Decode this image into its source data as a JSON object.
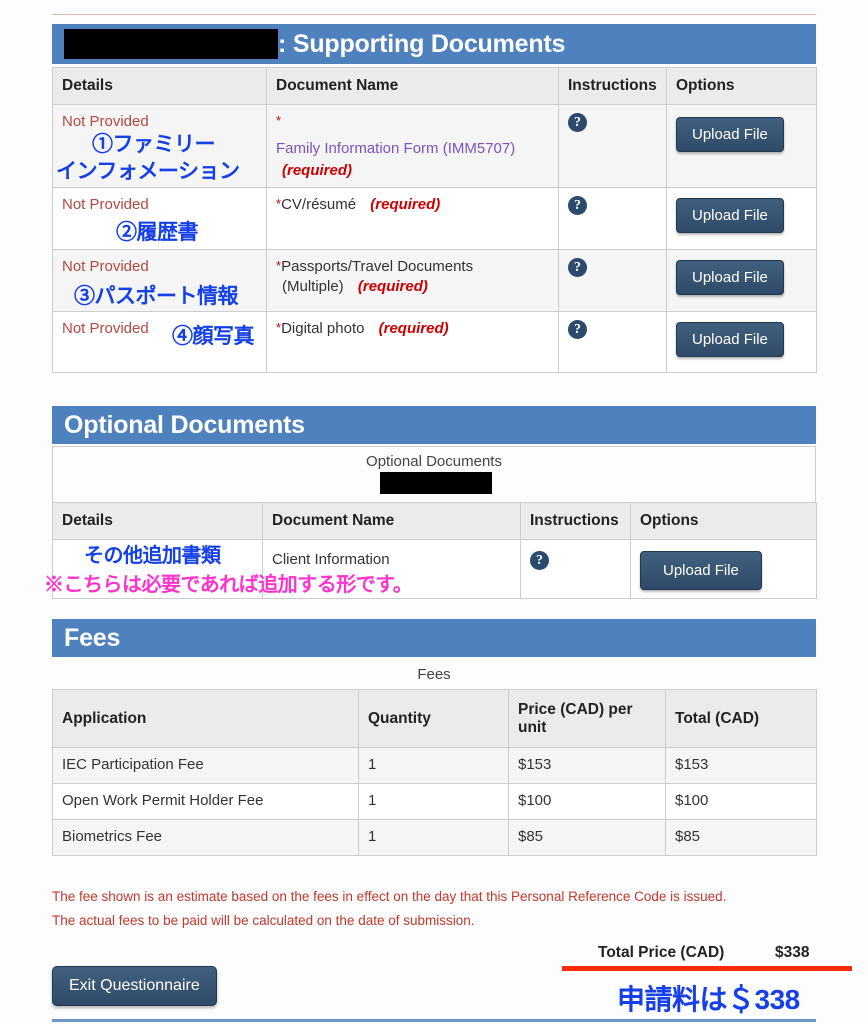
{
  "sections": {
    "supporting": {
      "title_suffix": ": Supporting Documents",
      "redacted_label": "redacted-name"
    },
    "optional": {
      "title": "Optional Documents",
      "caption": "Optional Documents",
      "redacted_label": "redacted-name"
    },
    "fees": {
      "title": "Fees",
      "caption": "Fees"
    }
  },
  "supporting_table": {
    "headers": [
      "Details",
      "Document Name",
      "Instructions",
      "Options"
    ],
    "rows": [
      {
        "status": "Not Provided",
        "asterisk": "*",
        "doc_name": "Family Information Form (IMM5707)",
        "doc_name_is_link": true,
        "extra_line": "",
        "required": "(required)",
        "help_icon": "question-mark-icon",
        "button": "Upload File"
      },
      {
        "status": "Not Provided",
        "asterisk": "*",
        "doc_name": "CV/résumé",
        "doc_name_is_link": false,
        "extra_line": "",
        "required": "(required)",
        "help_icon": "question-mark-icon",
        "button": "Upload File"
      },
      {
        "status": "Not Provided",
        "asterisk": "*",
        "doc_name": "Passports/Travel Documents",
        "doc_name_is_link": false,
        "extra_line": "(Multiple)",
        "required": "(required)",
        "help_icon": "question-mark-icon",
        "button": "Upload File"
      },
      {
        "status": "Not Provided",
        "asterisk": "*",
        "doc_name": "Digital photo",
        "doc_name_is_link": false,
        "extra_line": "",
        "required": "(required)",
        "help_icon": "question-mark-icon",
        "button": "Upload File"
      }
    ]
  },
  "optional_table": {
    "headers": [
      "Details",
      "Document Name",
      "Instructions",
      "Options"
    ],
    "rows": [
      {
        "status": "",
        "doc_name": "Client Information",
        "help_icon": "question-mark-icon",
        "button": "Upload File"
      }
    ]
  },
  "fees_table": {
    "headers": [
      "Application",
      "Quantity",
      "Price (CAD) per unit",
      "Total (CAD)"
    ],
    "rows": [
      {
        "application": "IEC Participation Fee",
        "quantity": "1",
        "price": "$153",
        "total": "$153"
      },
      {
        "application": "Open Work Permit Holder Fee",
        "quantity": "1",
        "price": "$100",
        "total": "$100"
      },
      {
        "application": "Biometrics Fee",
        "quantity": "1",
        "price": "$85",
        "total": "$85"
      }
    ]
  },
  "disclaimer": {
    "line1": "The fee shown is an estimate based on the fees in effect on the day that this Personal Reference Code is issued.",
    "line2": "The actual fees to be paid will be calculated on the date of submission."
  },
  "total": {
    "label": "Total Price (CAD)",
    "value": "$338"
  },
  "footer": {
    "exit_button": "Exit Questionnaire"
  },
  "annotations": {
    "jp1_line1": "①ファミリー",
    "jp1_line2": "インフォメーション",
    "jp2": "②履歴書",
    "jp3": "③パスポート情報",
    "jp4": "④顔写真",
    "jp_optional": "その他追加書類",
    "jp_optional_note": "※こちらは必要であれば追加する形です。",
    "jp_total": "申請料は＄338"
  },
  "colors": {
    "section_bar": "#4e81bd",
    "button_navy": "#375575",
    "annotation_blue": "#1540e8",
    "annotation_pink": "#ff33cc",
    "required_red": "#cc0000",
    "status_red": "#b5493f",
    "doc_link_purple": "#7b52c0",
    "total_underline": "#fd2a07"
  }
}
